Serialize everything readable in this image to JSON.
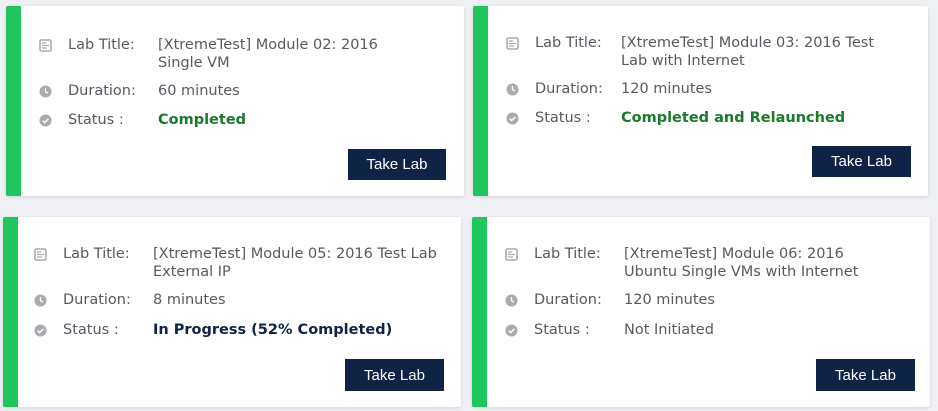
{
  "colors": {
    "accent": "#21c55d",
    "button": "#0f2347",
    "completed": "#1b7a2a",
    "in_progress": "#0f2347",
    "icon": "#a8acb0"
  },
  "labels": {
    "title": "Lab Title:",
    "duration": "Duration:",
    "status": "Status :"
  },
  "icons": {
    "title": "lab-icon",
    "duration": "clock-icon",
    "status": "check-circle-icon"
  },
  "cards": [
    {
      "title": "[XtremeTest] Module 02: 2016 Single VM",
      "duration": "60 minutes",
      "status": "Completed",
      "status_kind": "completed",
      "button_label": "Take Lab"
    },
    {
      "title": "[XtremeTest] Module 03: 2016 Test Lab with Internet",
      "duration": "120 minutes",
      "status": "Completed and Relaunched",
      "status_kind": "completed",
      "button_label": "Take Lab"
    },
    {
      "title": "[XtremeTest] Module 05: 2016 Test Lab External IP",
      "duration": "8 minutes",
      "status": "In Progress (52% Completed)",
      "status_kind": "in_progress",
      "button_label": "Take Lab"
    },
    {
      "title": "[XtremeTest] Module 06: 2016 Ubuntu Single VMs with Internet",
      "duration": "120 minutes",
      "status": "Not Initiated",
      "status_kind": "not_initiated",
      "button_label": "Take Lab"
    }
  ]
}
